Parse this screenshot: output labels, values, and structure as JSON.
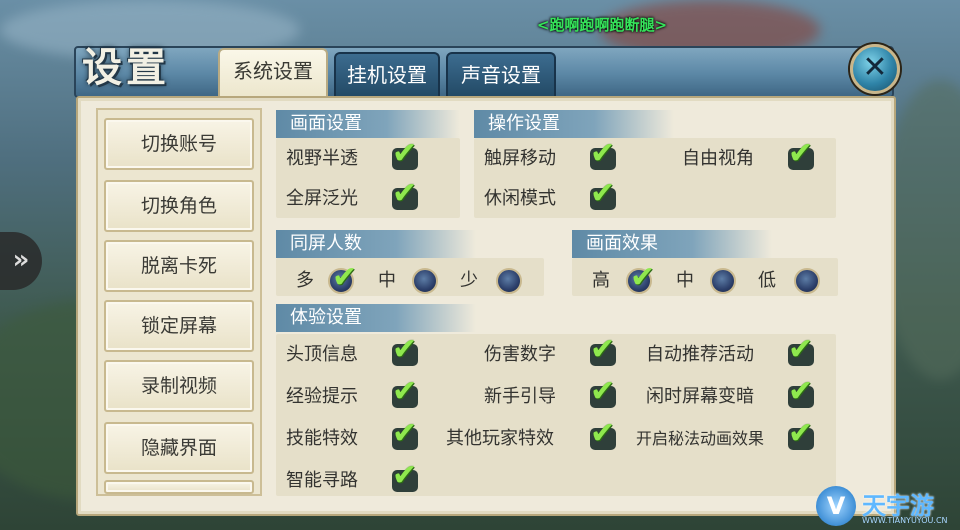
{
  "overhead_name": "<跑啊跑啊跑断腿>",
  "overhead_subtext": "",
  "side_arrow": "»",
  "dialog": {
    "title": "设置",
    "tabs": [
      {
        "label": "系统设置",
        "active": true
      },
      {
        "label": "挂机设置",
        "active": false
      },
      {
        "label": "声音设置",
        "active": false
      }
    ],
    "close_symbol": "✕"
  },
  "sidebar": {
    "buttons": [
      "切换账号",
      "切换角色",
      "脱离卡死",
      "锁定屏幕",
      "录制视频",
      "隐藏界面"
    ]
  },
  "groups": {
    "screen": {
      "header": "画面设置",
      "items": [
        {
          "label": "视野半透",
          "checked": true
        },
        {
          "label": "全屏泛光",
          "checked": true
        }
      ]
    },
    "control": {
      "header": "操作设置",
      "items": [
        {
          "label": "触屏移动",
          "checked": true
        },
        {
          "label": "自由视角",
          "checked": true
        },
        {
          "label": "休闲模式",
          "checked": true
        }
      ]
    },
    "players": {
      "header": "同屏人数",
      "options": [
        "多",
        "中",
        "少"
      ],
      "selected": "多"
    },
    "effects": {
      "header": "画面效果",
      "options": [
        "高",
        "中",
        "低"
      ],
      "selected": "高"
    },
    "experience": {
      "header": "体验设置",
      "items": [
        {
          "label": "头顶信息",
          "checked": true
        },
        {
          "label": "伤害数字",
          "checked": true
        },
        {
          "label": "自动推荐活动",
          "checked": true
        },
        {
          "label": "经验提示",
          "checked": true
        },
        {
          "label": "新手引导",
          "checked": true
        },
        {
          "label": "闲时屏幕变暗",
          "checked": true
        },
        {
          "label": "技能特效",
          "checked": true
        },
        {
          "label": "其他玩家特效",
          "checked": true
        },
        {
          "label": "开启秘法动画效果",
          "checked": true
        },
        {
          "label": "智能寻路",
          "checked": true
        }
      ]
    }
  },
  "check_mark": "✔",
  "watermark": {
    "logo": "V",
    "text": "天宇游",
    "url": "WWW.TIANYUYOU.CN"
  },
  "colors": {
    "header_blue": "#5f8aa6",
    "check_green": "#8fe84e",
    "panel_bg": "#efeadb"
  }
}
